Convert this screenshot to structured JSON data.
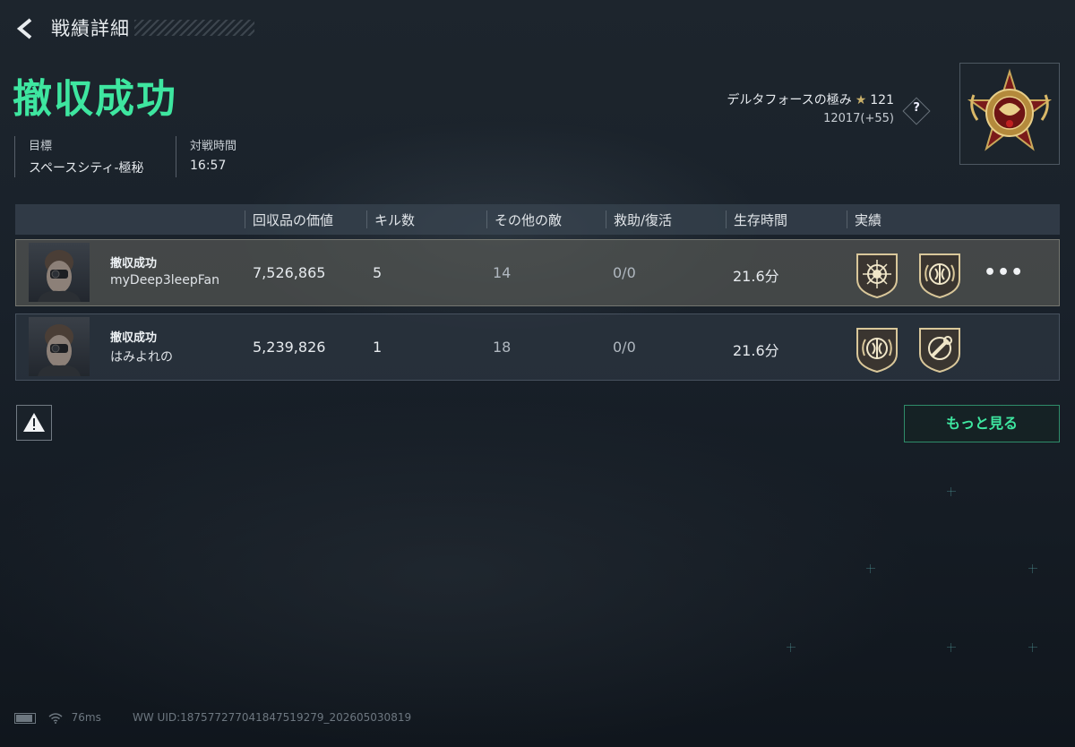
{
  "header": {
    "title": "戦績詳細",
    "result": "撤収成功",
    "target_label": "目標",
    "target_value": "スペースシティ-極秘",
    "time_label": "対戦時間",
    "time_value": "16:57"
  },
  "rank": {
    "name": "デルタフォースの極み",
    "level": "121",
    "points": "12017(+55)",
    "help": "?"
  },
  "table": {
    "columns": [
      "回収品の価値",
      "キル数",
      "その他の敵",
      "救助/復活",
      "生存時間",
      "実績"
    ],
    "rows": [
      {
        "status": "撤収成功",
        "name": "myDeep3leepFan",
        "value": "7,526,865",
        "kills": "5",
        "others": "14",
        "rescue": "0/0",
        "survival": "21.6分",
        "badges": [
          "sun-badge-icon",
          "emblem-badge-icon"
        ],
        "more": "•••"
      },
      {
        "status": "撤収成功",
        "name": "はみよれの",
        "value": "5,239,826",
        "kills": "1",
        "others": "18",
        "rescue": "0/0",
        "survival": "21.6分",
        "badges": [
          "emblem-badge-icon",
          "wrench-badge-icon"
        ]
      }
    ]
  },
  "actions": {
    "more": "もっと見る"
  },
  "footer": {
    "ping": "76ms",
    "uid": "WW UID:18757727704184751927​9_202605030819"
  },
  "colors": {
    "accent": "#3ee6a0",
    "background": "#19212a",
    "gold": "#c9b06a"
  }
}
